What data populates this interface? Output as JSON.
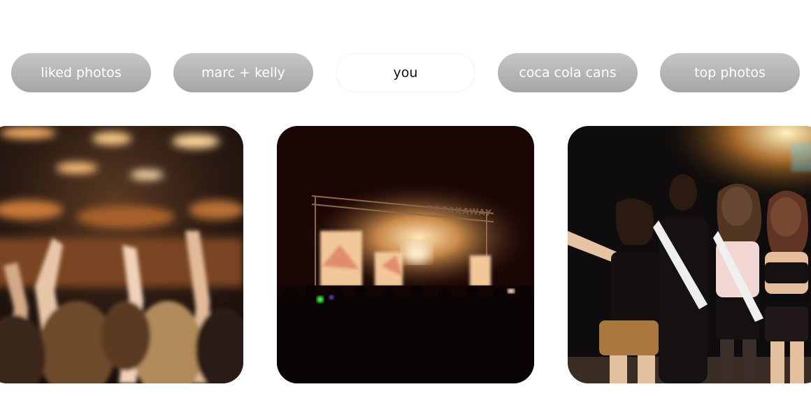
{
  "albums": {
    "tabs": [
      {
        "label": "liked photos",
        "active": false
      },
      {
        "label": "marc + kelly",
        "active": false
      },
      {
        "label": "you",
        "active": true
      },
      {
        "label": "coca cola cans",
        "active": false
      },
      {
        "label": "top photos",
        "active": false
      }
    ]
  },
  "gallery": {
    "photos": [
      {
        "subject": "blurred concert crowd with raised hands"
      },
      {
        "subject": "festival main stage at night",
        "stage_sign": "BREAKAWAY"
      },
      {
        "subject": "group of friends posing with sashes at night festival"
      }
    ]
  },
  "colors": {
    "tab_inactive": "#b4b4b4",
    "tab_active": "#ffffff",
    "tab_text_inactive": "#ffffff",
    "tab_text_active": "#111111"
  }
}
